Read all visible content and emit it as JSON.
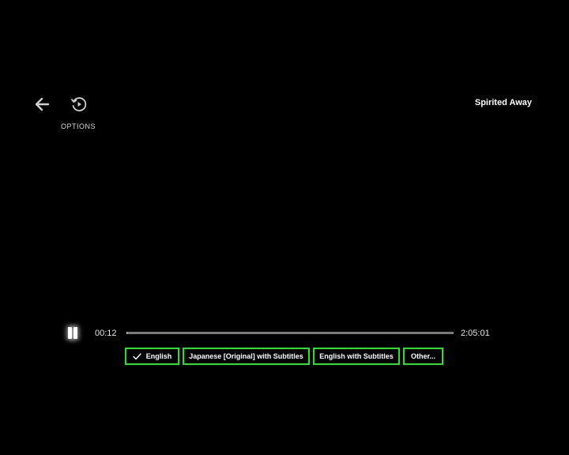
{
  "header": {
    "options_label": "OPTIONS",
    "title": "Spirited Away"
  },
  "icons": {
    "back": "arrow-left-icon",
    "options": "history-play-icon",
    "pause": "pause-icon",
    "check": "checkmark-icon"
  },
  "playback": {
    "elapsed": "00:12",
    "total": "2:05:01",
    "progress_fraction": 0.0016
  },
  "audio_options": [
    {
      "label": "English",
      "selected": true
    },
    {
      "label": "Japanese [Original] with Subtitles",
      "selected": false
    },
    {
      "label": "English with Subtitles",
      "selected": false
    },
    {
      "label": "Other...",
      "selected": false
    }
  ],
  "colors": {
    "background": "#000000",
    "highlight_border": "#22e622"
  }
}
